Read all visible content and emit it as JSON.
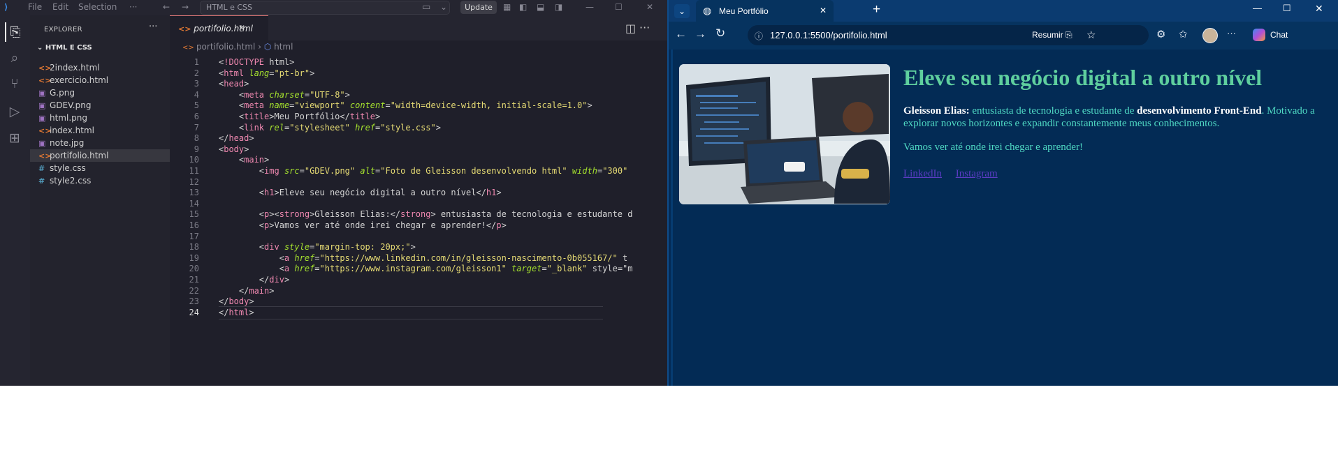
{
  "vscode": {
    "menu": [
      "File",
      "Edit",
      "Selection",
      "···"
    ],
    "search_text": "HTML e CSS",
    "update_label": "Update",
    "explorer_title": "EXPLORER",
    "explorer_more": "···",
    "folder_name": "HTML E CSS",
    "files": [
      {
        "name": "2index.html",
        "icon": "<>",
        "color": "#e37933"
      },
      {
        "name": "exercicio.html",
        "icon": "<>",
        "color": "#e37933"
      },
      {
        "name": "G.png",
        "icon": "▣",
        "color": "#a074c4"
      },
      {
        "name": "GDEV.png",
        "icon": "▣",
        "color": "#a074c4"
      },
      {
        "name": "html.png",
        "icon": "▣",
        "color": "#a074c4"
      },
      {
        "name": "index.html",
        "icon": "<>",
        "color": "#e37933"
      },
      {
        "name": "note.jpg",
        "icon": "▣",
        "color": "#a074c4"
      },
      {
        "name": "portifolio.html",
        "icon": "<>",
        "color": "#e37933"
      },
      {
        "name": "style.css",
        "icon": "#",
        "color": "#519aba"
      },
      {
        "name": "style2.css",
        "icon": "#",
        "color": "#519aba"
      }
    ],
    "selected_file_index": 7,
    "tab_label": "portifolio.html",
    "breadcrumb": [
      "portifolio.html",
      "html"
    ],
    "current_line": 24,
    "code_lines": [
      "<!DOCTYPE html>",
      "<html lang=\"pt-br\">",
      "<head>",
      "    <meta charset=\"UTF-8\">",
      "    <meta name=\"viewport\" content=\"width=device-width, initial-scale=1.0\">",
      "    <title>Meu Portfólio</title>",
      "    <link rel=\"stylesheet\" href=\"style.css\">",
      "</head>",
      "<body>",
      "    <main>",
      "        <img src=\"GDEV.png\" alt=\"Foto de Gleisson desenvolvendo html\" width=\"300\"",
      "",
      "        <h1>Eleve seu negócio digital a outro nível</h1>",
      "",
      "        <p><strong>Gleisson Elias:</strong> entusiasta de tecnologia e estudante d",
      "        <p>Vamos ver até onde irei chegar e aprender!</p>",
      "",
      "        <div style=\"margin-top: 20px;\">",
      "            <a href=\"https://www.linkedin.com/in/gleisson-nascimento-0b055167/\" t",
      "            <a href=\"https://www.instagram.com/gleisson1\" target=\"_blank\" style=\"m",
      "        </div>",
      "    </main>",
      "</body>",
      "</html>"
    ]
  },
  "browser": {
    "tab_title": "Meu Portfólio",
    "url": "127.0.0.1:5500/portifolio.html",
    "summarize_label": "Resumir",
    "chat_label": "Chat",
    "page": {
      "h1": "Eleve seu negócio digital a outro nível",
      "p1_strong": "Gleisson Elias:",
      "p1_text_a": " entusiasta de tecnologia e estudante de ",
      "p1_strong2": "desenvolvimento Front-End",
      "p1_text_b": ". Motivado a explorar novos horizontes e expandir constantemente meus conhecimentos.",
      "p2": "Vamos ver até onde irei chegar e aprender!",
      "link_linkedin": "LinkedIn",
      "link_instagram": "Instagram"
    }
  }
}
